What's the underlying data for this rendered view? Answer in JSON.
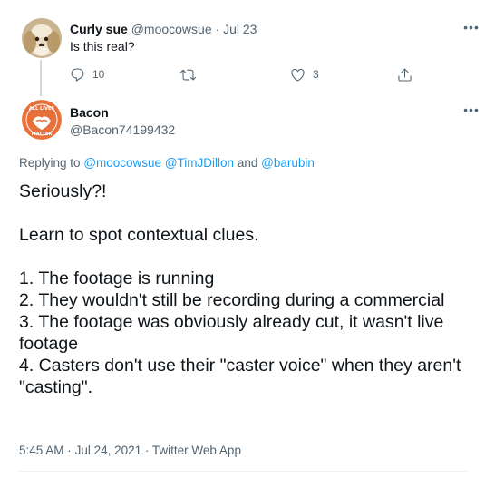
{
  "colors": {
    "text": "#0f1419",
    "muted": "#536471",
    "link": "#1d9bf0",
    "avatar_bacon": "#e8703a"
  },
  "reply_tweet": {
    "display_name": "Curly sue",
    "handle": "@moocowsue",
    "separator": "·",
    "date": "Jul 23",
    "text": "Is this real?",
    "reply_count": "10",
    "retweet_count": "",
    "like_count": "3",
    "icons": {
      "reply": "reply-icon",
      "retweet": "retweet-icon",
      "like": "like-icon",
      "share": "share-icon",
      "more": "more-icon"
    }
  },
  "main_tweet": {
    "display_name": "Bacon",
    "handle": "@Bacon74199432",
    "avatar_text_top": "ALL LIVES",
    "avatar_text_bottom": "MATTER",
    "replying_prefix": "Replying to",
    "mention_1": "@moocowsue",
    "mention_2": "@TimJDillon",
    "replying_and": "and",
    "mention_3": "@barubin",
    "paragraph_1": "Seriously?!",
    "paragraph_2": "Learn to spot contextual clues.",
    "list_1": "1.  The footage is running",
    "list_2": "2.  They wouldn't still be recording during a commercial",
    "list_3": "3.  The footage was obviously already cut, it wasn't live footage",
    "list_4": "4.  Casters don't use their \"caster voice\" when they aren't \"casting\".",
    "time": "5:45 AM",
    "separator": "·",
    "date": "Jul 24, 2021",
    "source": "Twitter Web App"
  }
}
